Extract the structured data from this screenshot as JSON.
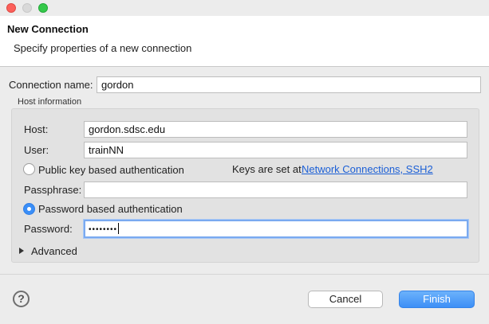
{
  "window": {
    "close_color": "#fc605b",
    "minimize_color": "#d9d9d9",
    "maximize_color": "#35c94a"
  },
  "banner": {
    "title": "New Connection",
    "description": "Specify properties of a new connection"
  },
  "form": {
    "connection_name_label": "Connection name:",
    "connection_name_value": "gordon",
    "host_group_label": "Host information",
    "host_label": "Host:",
    "host_value": "gordon.sdsc.edu",
    "user_label": "User:",
    "user_value": "trainNN",
    "pubkey_option_label": "Public key based authentication",
    "pubkey_selected": false,
    "keys_note": "Keys are set at",
    "keys_link": "Network Connections, SSH2",
    "passphrase_label": "Passphrase:",
    "passphrase_value": "",
    "password_option_label": "Password based authentication",
    "password_selected": true,
    "password_label": "Password:",
    "password_value": "••••••••",
    "advanced_label": "Advanced"
  },
  "footer": {
    "help_icon": "question-circle-icon",
    "help_glyph": "?",
    "cancel_label": "Cancel",
    "finish_label": "Finish"
  },
  "colors": {
    "accent": "#3a8ef7",
    "link": "#1b5fd6"
  }
}
